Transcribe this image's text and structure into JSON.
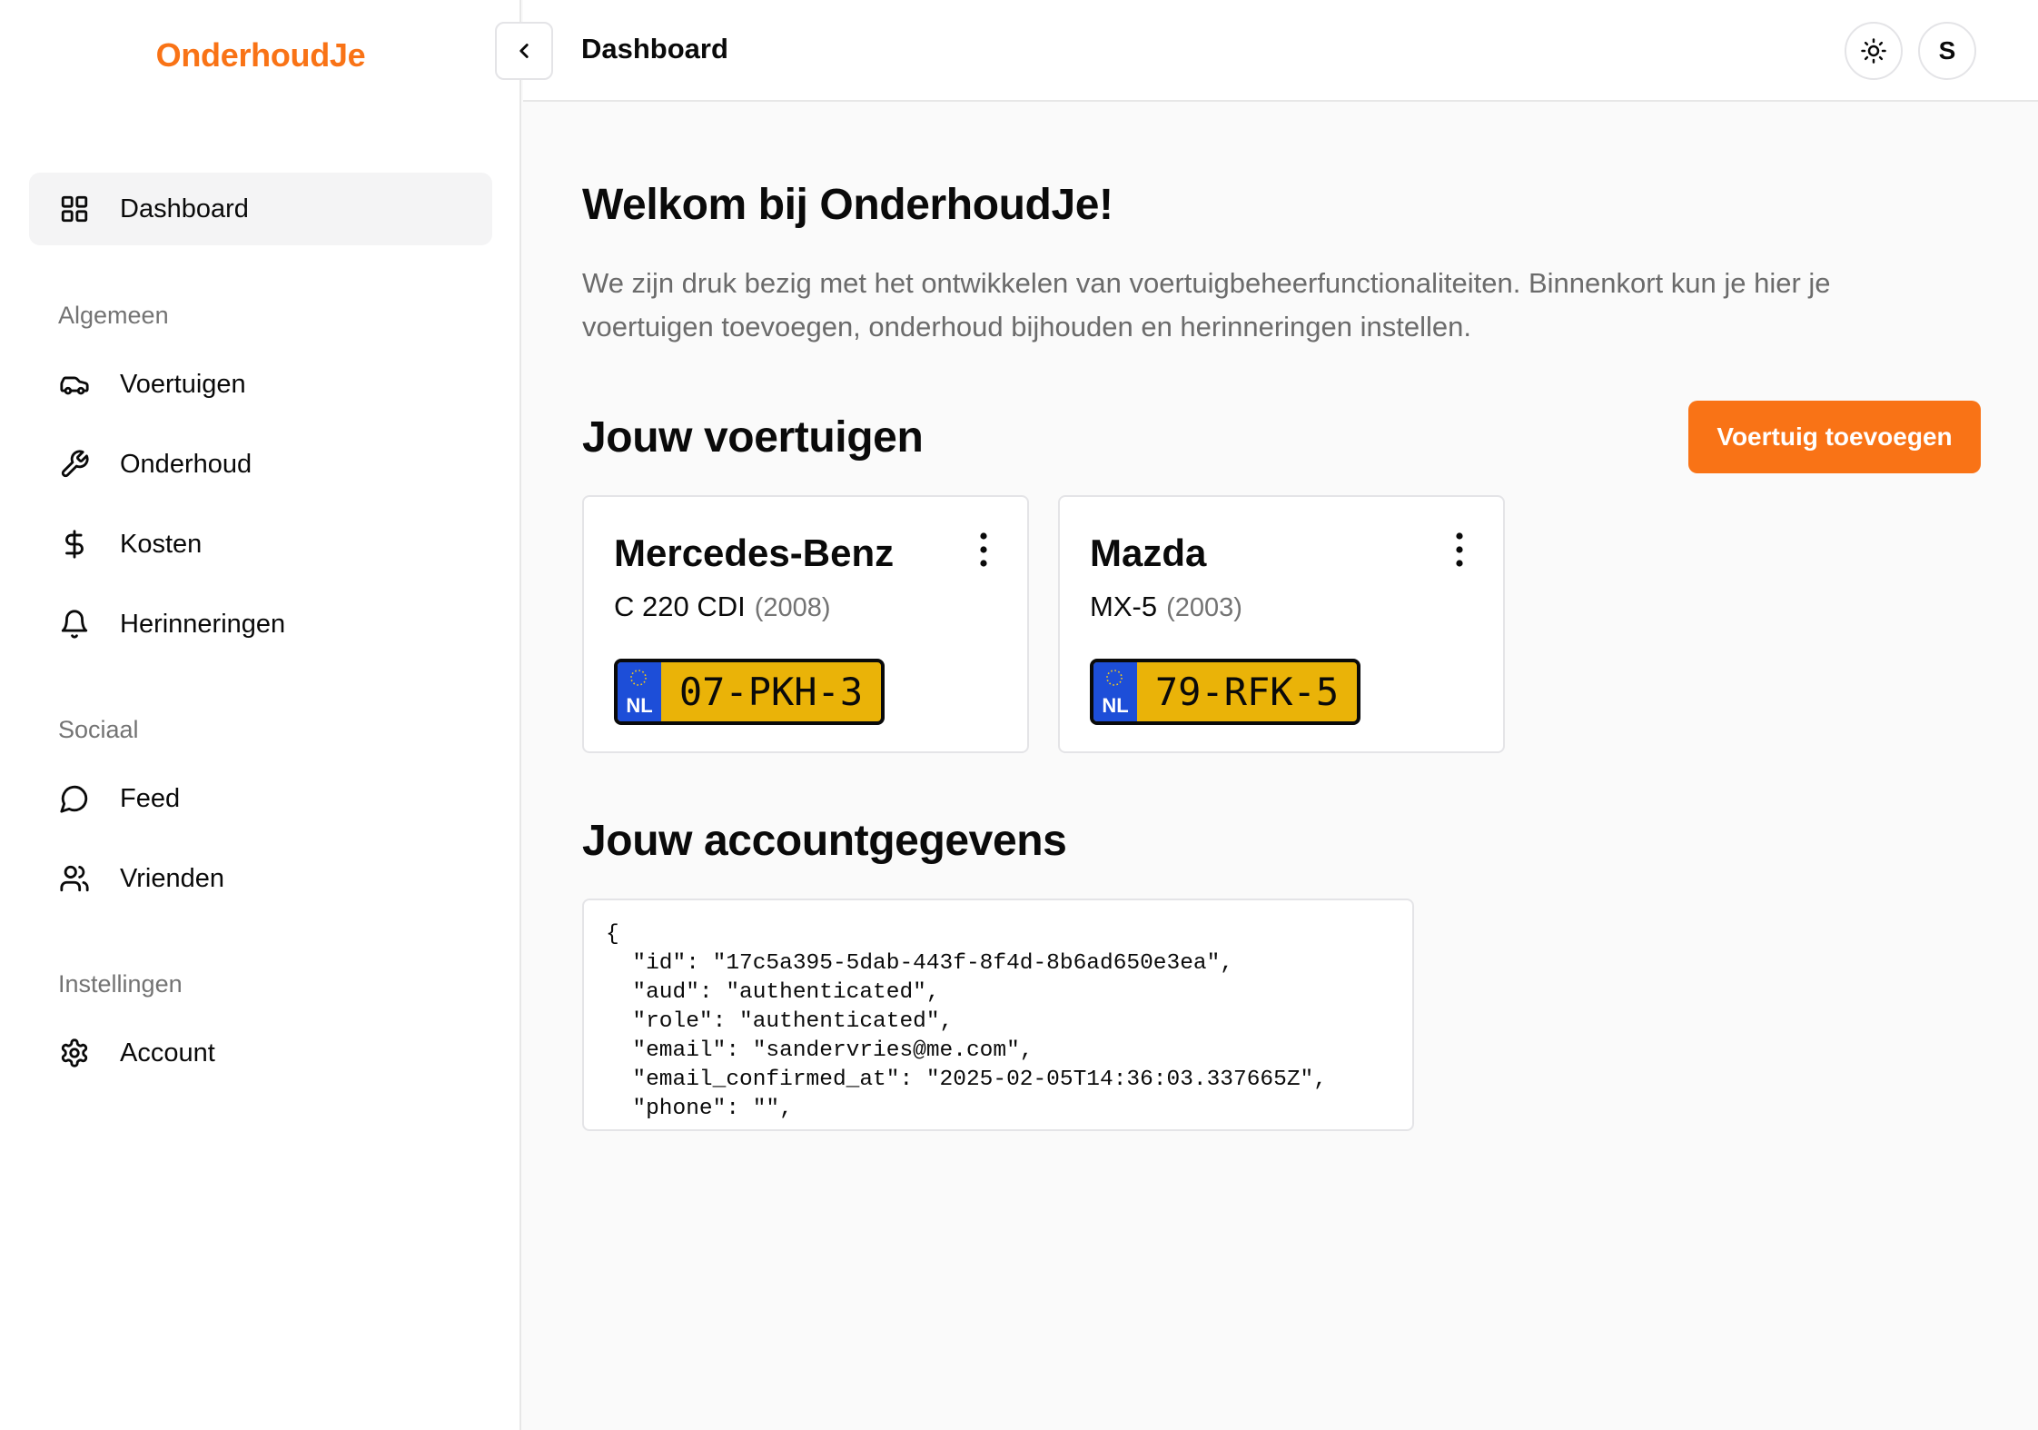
{
  "app": {
    "brand": "OnderhoudJe",
    "brand_color": "#f97316"
  },
  "sidebar": {
    "active": {
      "label": "Dashboard",
      "icon": "layout-grid-icon"
    },
    "sections": [
      {
        "label": "Algemeen",
        "items": [
          {
            "label": "Voertuigen",
            "icon": "car-icon"
          },
          {
            "label": "Onderhoud",
            "icon": "wrench-icon"
          },
          {
            "label": "Kosten",
            "icon": "dollar-icon"
          },
          {
            "label": "Herinneringen",
            "icon": "bell-icon"
          }
        ]
      },
      {
        "label": "Sociaal",
        "items": [
          {
            "label": "Feed",
            "icon": "chat-bubble-icon"
          },
          {
            "label": "Vrienden",
            "icon": "users-icon"
          }
        ]
      },
      {
        "label": "Instellingen",
        "items": [
          {
            "label": "Account",
            "icon": "gear-icon"
          }
        ]
      }
    ]
  },
  "header": {
    "title": "Dashboard",
    "collapse_icon": "chevron-left-icon",
    "theme_icon": "sun-icon",
    "avatar_initial": "S"
  },
  "main": {
    "welcome_title": "Welkom bij OnderhoudJe!",
    "welcome_text": "We zijn druk bezig met het ontwikkelen van voertuigbeheerfunctionaliteiten. Binnenkort kun je hier je voertuigen toevoegen, onderhoud bijhouden en herinneringen instellen.",
    "vehicles_title": "Jouw voertuigen",
    "add_vehicle_label": "Voertuig toevoegen",
    "vehicles": [
      {
        "make": "Mercedes-Benz",
        "model": "C 220 CDI",
        "year": "(2008)",
        "plate_country": "NL",
        "plate": "07-PKH-3"
      },
      {
        "make": "Mazda",
        "model": "MX-5",
        "year": "(2003)",
        "plate_country": "NL",
        "plate": "79-RFK-5"
      }
    ],
    "account_title": "Jouw accountgegevens",
    "account_json_lines": [
      "{",
      "  \"id\": \"17c5a395-5dab-443f-8f4d-8b6ad650e3ea\",",
      "  \"aud\": \"authenticated\",",
      "  \"role\": \"authenticated\",",
      "  \"email\": \"sandervries@me.com\",",
      "  \"email_confirmed_at\": \"2025-02-05T14:36:03.337665Z\",",
      "  \"phone\": \"\","
    ]
  }
}
